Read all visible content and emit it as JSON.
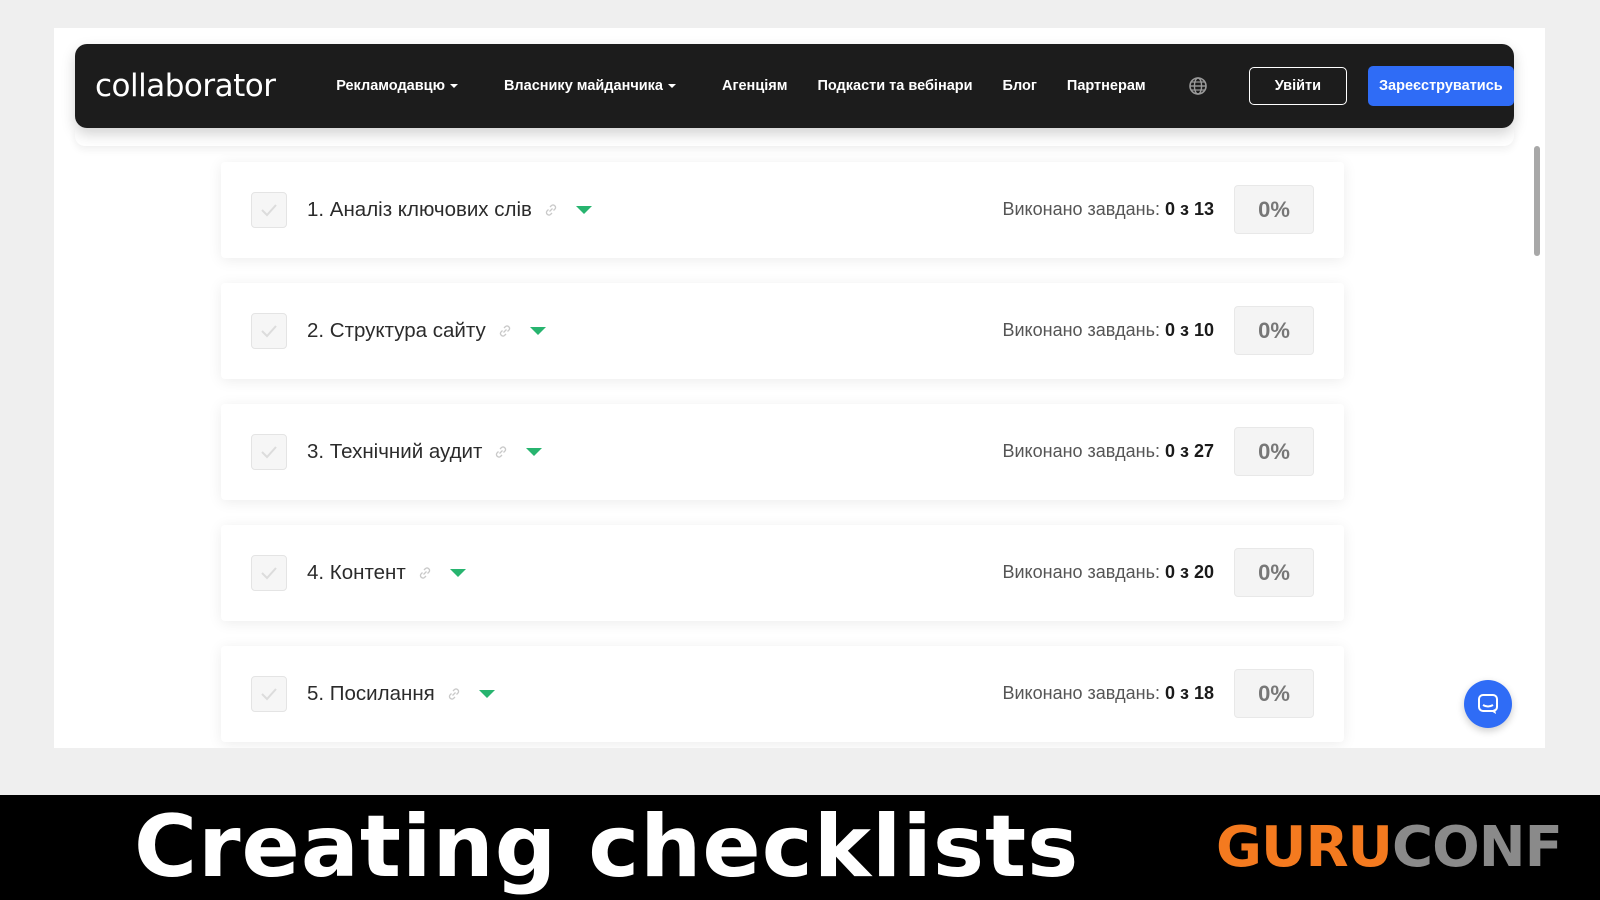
{
  "navbar": {
    "logo": "collaborator",
    "items": [
      {
        "label": "Рекламодавцю",
        "dropdown": true
      },
      {
        "label": "Власнику майданчика",
        "dropdown": true
      },
      {
        "label": "Агенціям",
        "dropdown": false
      },
      {
        "label": "Подкасти та вебінари",
        "dropdown": false
      },
      {
        "label": "Блог",
        "dropdown": false
      },
      {
        "label": "Партнерам",
        "dropdown": false
      }
    ],
    "language_icon": "globe-icon",
    "login_label": "Увійти",
    "register_label": "Зареєструватись",
    "accent_color": "#2f6cf6"
  },
  "checklist": {
    "progress_label": "Виконано завдань:",
    "toggle_color": "#27b46f",
    "sections": [
      {
        "title": "1. Аналіз ключових слів",
        "done": "0 з 13",
        "percent": "0%"
      },
      {
        "title": "2. Структура сайту",
        "done": "0 з 10",
        "percent": "0%"
      },
      {
        "title": "3. Технічний аудит",
        "done": "0 з 27",
        "percent": "0%"
      },
      {
        "title": "4. Контент",
        "done": "0 з 20",
        "percent": "0%"
      },
      {
        "title": "5. Посилання",
        "done": "0 з 18",
        "percent": "0%"
      }
    ]
  },
  "chat_widget": {
    "icon": "chat-icon"
  },
  "caption": {
    "text": "Creating checklists",
    "brand_part1": "GURU",
    "brand_part2": "CONF",
    "brand_color": "#f47a1f"
  }
}
